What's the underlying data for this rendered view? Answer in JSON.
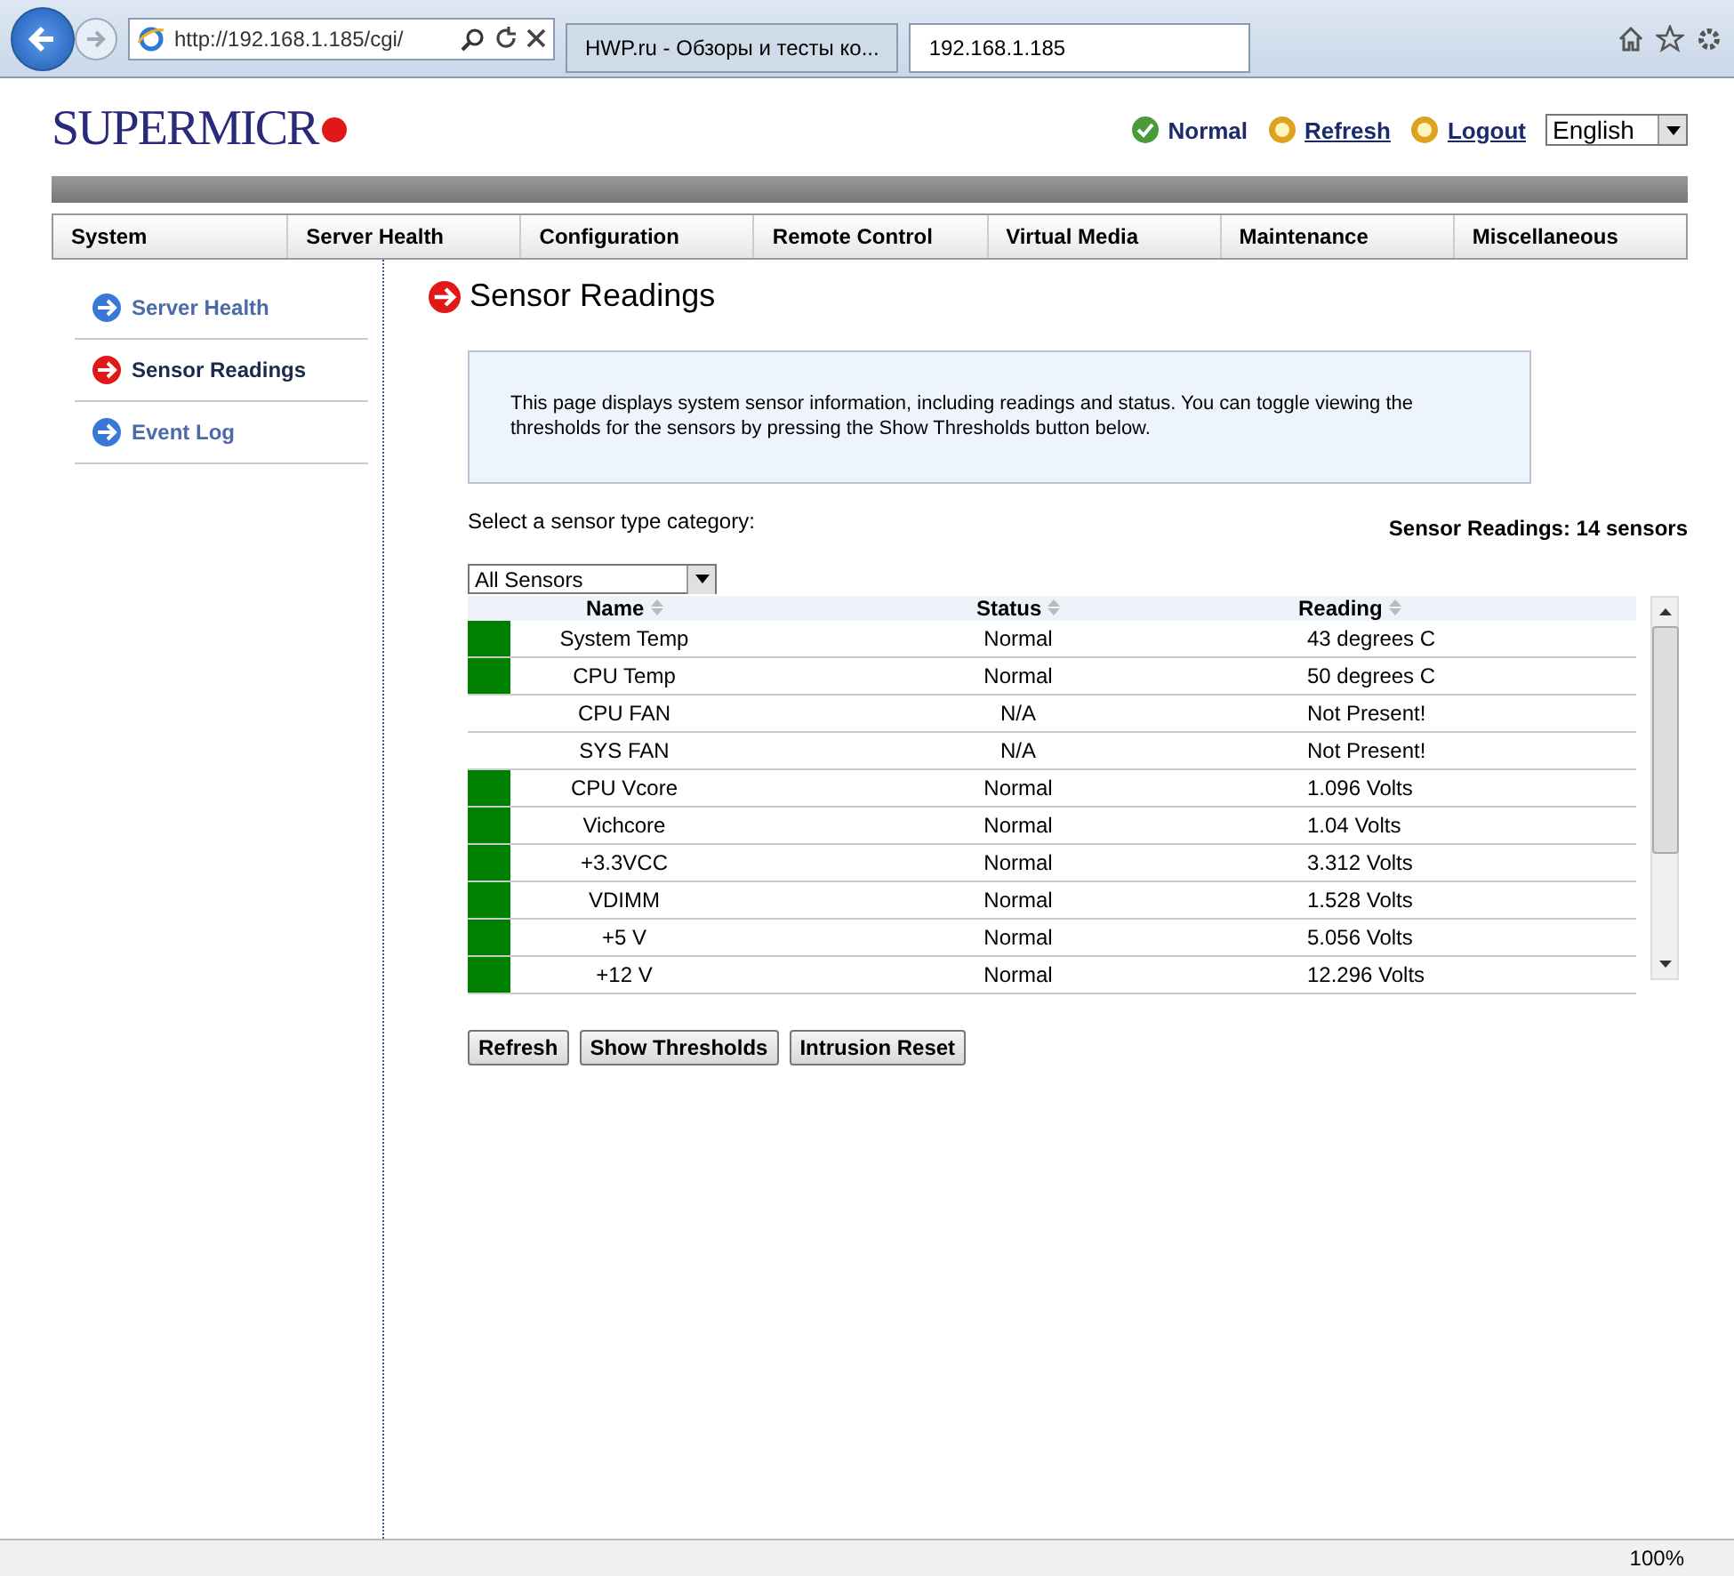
{
  "browser": {
    "address": "http://192.168.1.185/cgi/",
    "tabs": [
      {
        "label": "HWP.ru - Обзоры и тесты ко...",
        "selected": false
      },
      {
        "label": "192.168.1.185",
        "selected": true
      }
    ]
  },
  "header": {
    "logo": "SUPERMICR",
    "status": "Normal",
    "links": [
      "Refresh",
      "Logout"
    ],
    "language": "English"
  },
  "menu": [
    "System",
    "Server Health",
    "Configuration",
    "Remote Control",
    "Virtual Media",
    "Maintenance",
    "Miscellaneous"
  ],
  "sidebar": [
    {
      "label": "Server Health",
      "selected": false
    },
    {
      "label": "Sensor Readings",
      "selected": true
    },
    {
      "label": "Event Log",
      "selected": false
    }
  ],
  "page_title": "Sensor Readings",
  "info": "This page displays system sensor information, including readings and status. You can toggle viewing the thresholds for the sensors by pressing the Show Thresholds button below.",
  "category_label": "Select a sensor type category:",
  "category": "All Sensors",
  "summary": "Sensor Readings: 14 sensors",
  "table": {
    "columns": [
      "Name",
      "Status",
      "Reading"
    ],
    "rows": [
      {
        "indicator": true,
        "name": "System Temp",
        "status": "Normal",
        "reading": "43 degrees C"
      },
      {
        "indicator": true,
        "name": "CPU Temp",
        "status": "Normal",
        "reading": "50 degrees C"
      },
      {
        "indicator": false,
        "name": "CPU FAN",
        "status": "N/A",
        "reading": "Not Present!"
      },
      {
        "indicator": false,
        "name": "SYS FAN",
        "status": "N/A",
        "reading": "Not Present!"
      },
      {
        "indicator": true,
        "name": "CPU Vcore",
        "status": "Normal",
        "reading": "1.096 Volts"
      },
      {
        "indicator": true,
        "name": "Vichcore",
        "status": "Normal",
        "reading": "1.04 Volts"
      },
      {
        "indicator": true,
        "name": "+3.3VCC",
        "status": "Normal",
        "reading": "3.312 Volts"
      },
      {
        "indicator": true,
        "name": "VDIMM",
        "status": "Normal",
        "reading": "1.528 Volts"
      },
      {
        "indicator": true,
        "name": "+5 V",
        "status": "Normal",
        "reading": "5.056 Volts"
      },
      {
        "indicator": true,
        "name": "+12 V",
        "status": "Normal",
        "reading": "12.296 Volts"
      }
    ]
  },
  "buttons": [
    "Refresh",
    "Show Thresholds",
    "Intrusion Reset"
  ],
  "status_bar": {
    "zoom": "100%"
  }
}
